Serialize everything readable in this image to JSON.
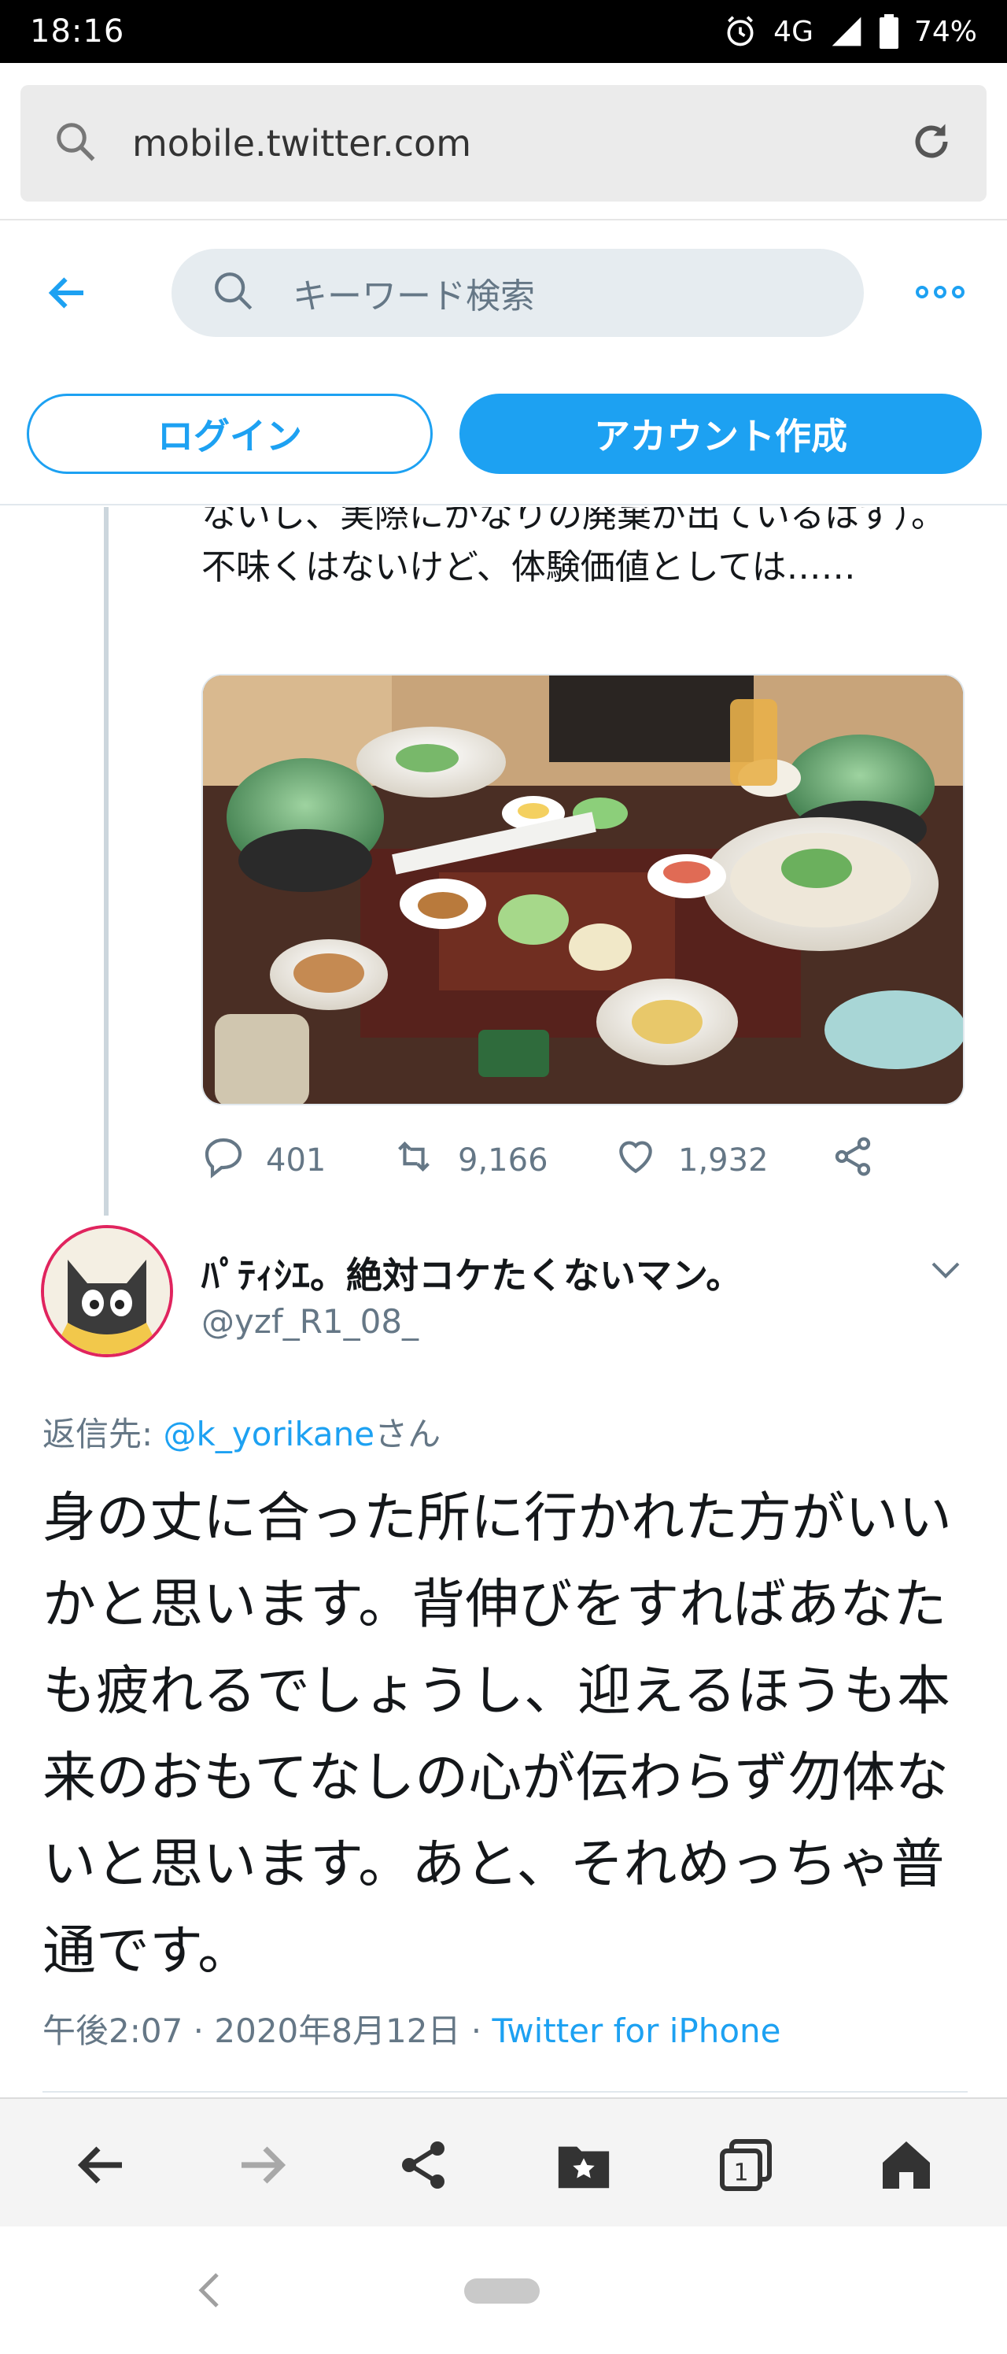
{
  "status_bar": {
    "time": "18:16",
    "network": "4G",
    "battery": "74%",
    "icons": [
      "alarm-icon",
      "signal-icon",
      "battery-icon"
    ]
  },
  "browser": {
    "url": "mobile.twitter.com",
    "icons": [
      "search-icon",
      "reload-icon"
    ]
  },
  "twitter_header": {
    "search_placeholder": "キーワード検索",
    "login_label": "ログイン",
    "signup_label": "アカウント作成",
    "accent_color": "#1da1f2"
  },
  "previous_tweet": {
    "text": "ないし、実際にかなりの廃棄が出ているはず）。不味くはないけど、体験価値としては……",
    "image_alt": "旅館の夕食（鍋物と小鉢が並ぶ食卓）",
    "stats": {
      "replies": "401",
      "retweets": "9,166",
      "likes": "1,932"
    }
  },
  "reply_tweet": {
    "display_name": "ﾊﾟﾃｨｼｴ。絶対コケたくないマン。",
    "handle": "@yzf_R1_08_",
    "reply_to_label": "返信先: ",
    "reply_to_mention": "@k_yorikane",
    "reply_to_suffix": "さん",
    "text": "身の丈に合った所に行かれた方がいいかと思います。背伸びをすればあなたも疲れるでしょうし、迎えるほうも本来のおもてなしの心が伝わらず勿体ないと思います。あと、それめっちゃ普通です。",
    "time": "午後2:07",
    "date": "2020年8月12日",
    "separator": " · ",
    "client": "Twitter for iPhone"
  },
  "browser_toolbar": {
    "items": [
      "back-icon",
      "forward-icon",
      "share-icon",
      "bookmark-icon",
      "tabs-icon",
      "home-icon"
    ],
    "tab_count": "1"
  }
}
